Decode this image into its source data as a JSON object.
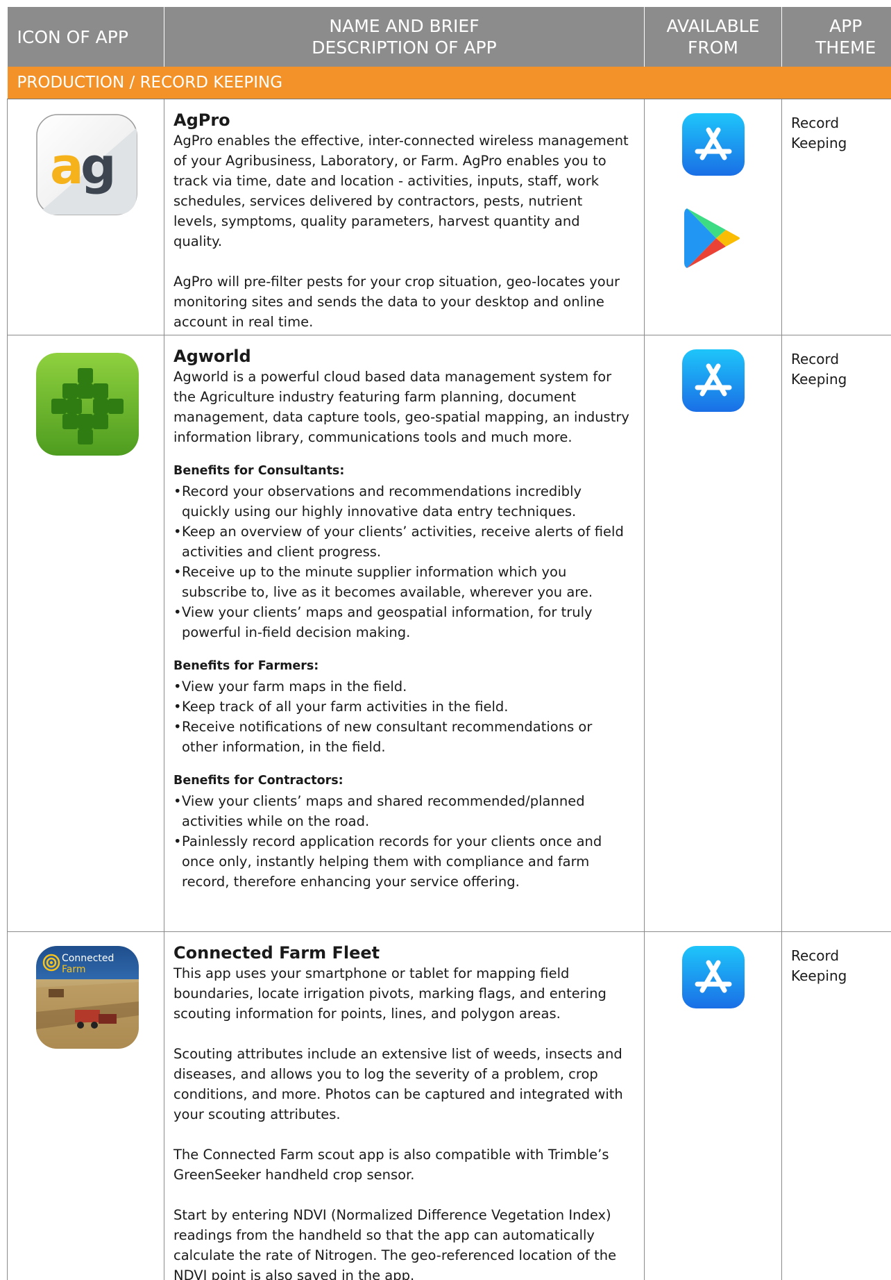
{
  "header": {
    "col_icon": "ICON OF APP",
    "col_name_line1": "NAME AND BRIEF",
    "col_name_line2": "DESCRIPTION OF APP",
    "col_available_line1": "AVAILABLE",
    "col_available_line2": "FROM",
    "col_theme_line1": "APP",
    "col_theme_line2": "THEME"
  },
  "section": {
    "title": "PRODUCTION / RECORD KEEPING"
  },
  "colors": {
    "header_bg": "#8c8c8c",
    "section_bg": "#f39229",
    "agworld_green": "#5fae2a",
    "appstore_blue": "#1f86e8"
  },
  "apps": [
    {
      "icon": "agpro-logo-icon",
      "icon_text_a": "a",
      "icon_text_g": "g",
      "name": "AgPro",
      "paras": [
        "AgPro enables the effective, inter-connected wireless management of your Agribusiness, Laboratory, or Farm. AgPro enables you to track via time, date and location - activities, inputs, staff, work schedules, services delivered by contractors, pests, nutrient levels, symptoms, quality parameters, harvest quantity and quality.",
        "AgPro will pre-filter pests for your crop situation, geo-locates your monitoring sites and sends the data to your desktop and online account in real time."
      ],
      "stores": [
        "app-store-icon",
        "google-play-icon"
      ],
      "theme_line1": "Record",
      "theme_line2": "Keeping"
    },
    {
      "icon": "agworld-logo-icon",
      "name": "Agworld",
      "paras": [
        "Agworld is a powerful cloud based data management system for the Agriculture industry featuring farm planning, document management, data capture tools, geo-spatial mapping, an industry information library, communications tools and much more."
      ],
      "groups": [
        {
          "title": "Benefits for Consultants:",
          "items": [
            "Record your observations and recommendations incredibly quickly using our highly innovative data entry techniques.",
            "Keep an overview of your clients’ activities, receive alerts of field activities and client progress.",
            "Receive up to the minute supplier information which you subscribe to, live as it becomes available, wherever you are.",
            "View your clients’ maps and geospatial information, for truly powerful in-field decision making."
          ]
        },
        {
          "title": "Benefits for Farmers:",
          "items": [
            "View your farm maps in the field.",
            "Keep track of all your farm activities in the field.",
            "Receive notifications of new consultant recommendations or other information, in the field."
          ]
        },
        {
          "title": "Benefits for Contractors:",
          "items": [
            "View your clients’ maps and shared recommended/planned activities while on the road.",
            "Painlessly record application records for your clients once and once only, instantly helping them with compliance and farm record, therefore enhancing your service offering."
          ]
        }
      ],
      "stores": [
        "app-store-icon"
      ],
      "theme_line1": "Record",
      "theme_line2": "Keeping"
    },
    {
      "icon": "connected-farm-logo-icon",
      "icon_text_line1": "Connected",
      "icon_text_line2": "Farm",
      "name": "Connected Farm Fleet",
      "paras": [
        "This app uses your smartphone or tablet for mapping field boundaries, locate irrigation pivots, marking flags, and entering scouting information for points, lines, and polygon areas.",
        "Scouting attributes include an extensive list of weeds, insects and diseases, and allows you to log the severity of a problem, crop conditions, and more. Photos can be captured and integrated with your scouting attributes.",
        "The Connected Farm scout app is also compatible with Trimble’s GreenSeeker handheld crop sensor.",
        "Start by entering NDVI (Normalized Difference Vegetation Index) readings from the handheld so that the app can automatically calculate the rate of Nitrogen. The geo-referenced location of the NDVI point is also saved in the app."
      ],
      "stores": [
        "app-store-icon"
      ],
      "theme_line1": "Record",
      "theme_line2": "Keeping"
    }
  ]
}
